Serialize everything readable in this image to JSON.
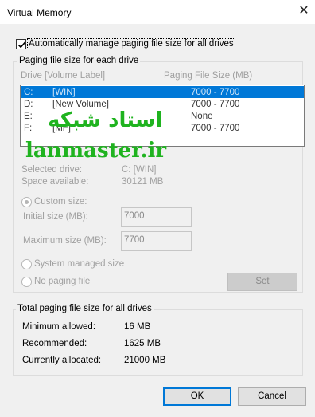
{
  "window": {
    "title": "Virtual Memory",
    "close_glyph": "✕"
  },
  "auto_manage": {
    "label": "Automatically manage paging file size for all drives",
    "checked": true
  },
  "paging_group": {
    "label": "Paging file size for each drive",
    "col_drive": "Drive  [Volume Label]",
    "col_size": "Paging File Size (MB)",
    "drives": [
      {
        "drive": "C:",
        "label": "[WIN]",
        "size": "7000 - 7700",
        "selected": true
      },
      {
        "drive": "D:",
        "label": "[New Volume]",
        "size": "7000 - 7700"
      },
      {
        "drive": "E:",
        "label": "",
        "size": "None"
      },
      {
        "drive": "F:",
        "label": "[MF]",
        "size": "7000 - 7700"
      }
    ],
    "selected_drive_label": "Selected drive:",
    "selected_drive_value": "C:  [WIN]",
    "space_available_label": "Space available:",
    "space_available_value": "30121 MB",
    "custom_size_label": "Custom size:",
    "initial_size_label": "Initial size (MB):",
    "initial_size_value": "7000",
    "max_size_label": "Maximum size (MB):",
    "max_size_value": "7700",
    "system_managed_label": "System managed size",
    "no_paging_label": "No paging file",
    "set_button": "Set"
  },
  "totals_group": {
    "label": "Total paging file size for all drives",
    "min_label": "Minimum allowed:",
    "min_value": "16 MB",
    "recommended_label": "Recommended:",
    "recommended_value": "1625 MB",
    "allocated_label": "Currently allocated:",
    "allocated_value": "21000 MB"
  },
  "buttons": {
    "ok": "OK",
    "cancel": "Cancel"
  },
  "watermark": {
    "fa": "استاد شبکه",
    "en": "lanmaster.ir"
  },
  "colors": {
    "selection": "#0078d7",
    "watermark": "#1fb31f",
    "default_button_border": "#0078d7"
  }
}
